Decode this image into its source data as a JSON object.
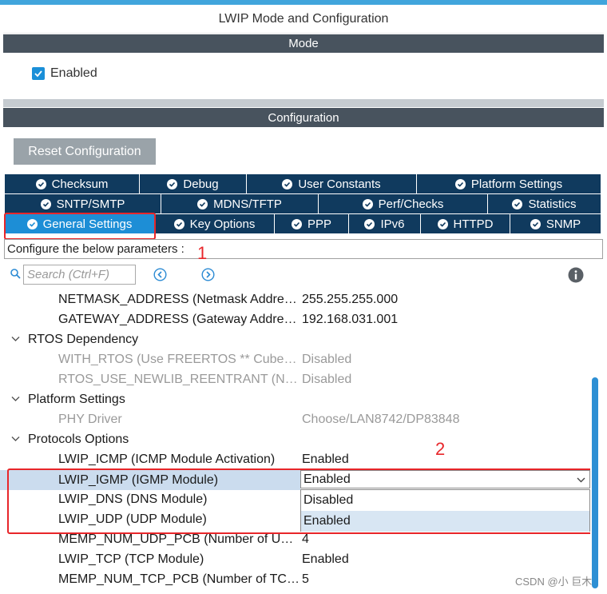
{
  "window": {
    "title": "LWIP Mode and Configuration"
  },
  "mode": {
    "header": "Mode",
    "enabled_label": "Enabled"
  },
  "configuration": {
    "header": "Configuration",
    "reset_label": "Reset Configuration"
  },
  "tabs": {
    "row1": [
      "Checksum",
      "Debug",
      "User Constants",
      "Platform Settings"
    ],
    "row2": [
      "SNTP/SMTP",
      "MDNS/TFTP",
      "Perf/Checks",
      "Statistics"
    ],
    "row3": [
      "General Settings",
      "Key Options",
      "PPP",
      "IPv6",
      "HTTPD",
      "SNMP"
    ],
    "active": "General Settings"
  },
  "params": {
    "label": "Configure the below parameters :",
    "search_placeholder": "Search (Ctrl+F)"
  },
  "tree": [
    {
      "name": "NETMASK_ADDRESS (Netmask Address)",
      "value": "255.255.255.000"
    },
    {
      "name": "GATEWAY_ADDRESS (Gateway Address)",
      "value": "192.168.031.001"
    },
    {
      "name": "RTOS Dependency",
      "value": ""
    },
    {
      "name": "WITH_RTOS (Use FREERTOS ** CubeMX specific **)",
      "value": "Disabled"
    },
    {
      "name": "RTOS_USE_NEWLIB_REENTRANT (Nothing)",
      "value": "Disabled"
    },
    {
      "name": "Platform Settings",
      "value": ""
    },
    {
      "name": "PHY Driver",
      "value": "Choose/LAN8742/DP83848"
    },
    {
      "name": "Protocols Options",
      "value": ""
    },
    {
      "name": "LWIP_ICMP (ICMP Module Activation)",
      "value": "Enabled"
    },
    {
      "name": "LWIP_IGMP (IGMP Module)",
      "value": "Enabled"
    },
    {
      "name": "LWIP_DNS (DNS Module)",
      "value": ""
    },
    {
      "name": "LWIP_UDP (UDP Module)",
      "value": ""
    },
    {
      "name": "MEMP_NUM_UDP_PCB (Number of UDP PCBs)",
      "value": "4"
    },
    {
      "name": "LWIP_TCP (TCP Module)",
      "value": "Enabled"
    },
    {
      "name": "MEMP_NUM_TCP_PCB (Number of TCP PCBs)",
      "value": "5"
    }
  ],
  "dropdown": {
    "selected": "Enabled",
    "options": [
      "Disabled",
      "Enabled"
    ]
  },
  "annotations": {
    "one": "1",
    "two": "2"
  },
  "watermark": "CSDN @小 巨木",
  "colors": {
    "accent": "#1d8ed6",
    "tab_bg": "#103a5e",
    "header_bg": "#48535e",
    "annotation": "#e8262a"
  },
  "icons": {
    "tab": "check-circle-icon",
    "search": "search-icon",
    "info": "info-icon"
  }
}
